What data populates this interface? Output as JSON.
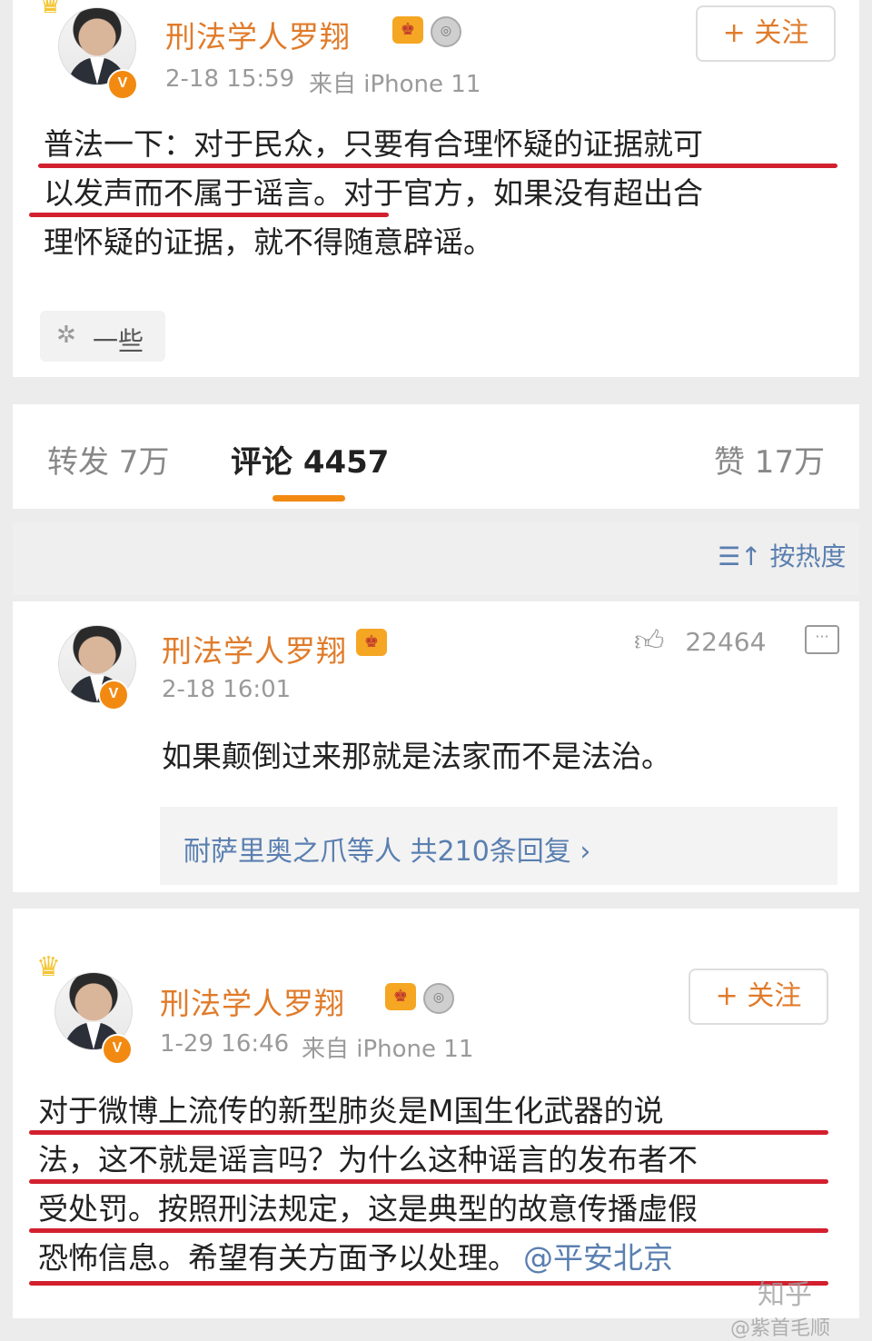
{
  "post1": {
    "author": "刑法学人罗翔",
    "vip_icon": "crown-vip-icon",
    "medal_icon": "medal-icon",
    "verified_badge": "V",
    "time": "2-18 15:59",
    "source": "来自 iPhone 11",
    "follow_label": "+ 关注",
    "lines": [
      "普法一下：对于民众，只要有合理怀疑的证据就可",
      "以发声而不属于谣言。对于官方，如果没有超出合",
      "理怀疑的证据，就不得随意辟谣。"
    ],
    "tag_label": "一些",
    "tag_icon": "topic-icon"
  },
  "tabs": {
    "repost": "转发 7万",
    "comment": "评论 4457",
    "like": "赞 17万",
    "sort_icon": "sort-icon",
    "sort_label": "按热度"
  },
  "comment": {
    "author": "刑法学人罗翔",
    "time": "2-18 16:01",
    "like_count": "22464",
    "text": "如果颠倒过来那就是法家而不是法治。",
    "replies": "耐萨里奥之爪等人  共210条回复  ›"
  },
  "post2": {
    "author": "刑法学人罗翔",
    "time": "1-29 16:46",
    "source": "来自 iPhone 11",
    "follow_label": "+ 关注",
    "lines": [
      "对于微博上流传的新型肺炎是M国生化武器的说",
      "法，这不就是谣言吗？为什么这种谣言的发布者不",
      "受处罚。按照刑法规定，这是典型的故意传播虚假"
    ],
    "last_line": "恐怖信息。希望有关方面予以处理。",
    "mention": "@平安北京"
  },
  "watermark": {
    "text1": "知乎",
    "text2": "@紫首毛顺"
  },
  "colors": {
    "accent": "#e07b2a",
    "underline": "#d2202f",
    "tab_indicator": "#f28a12"
  }
}
